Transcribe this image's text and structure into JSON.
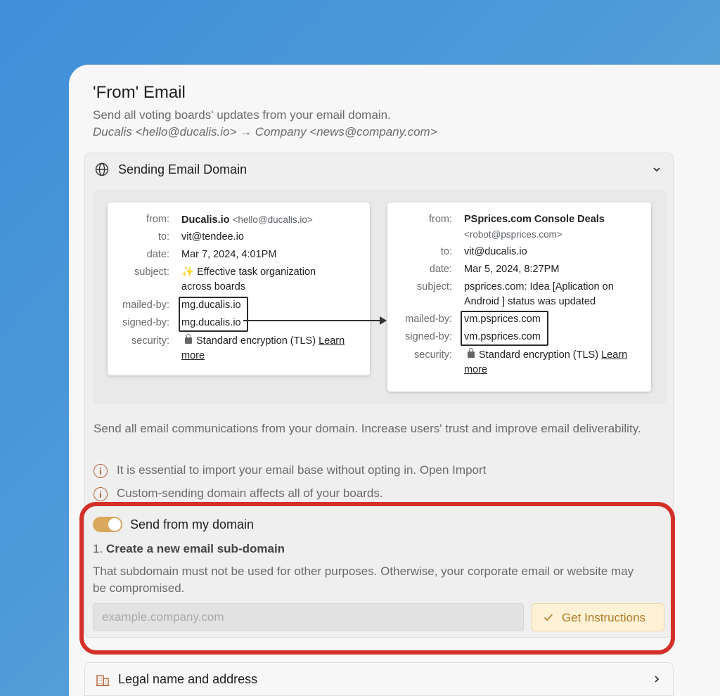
{
  "header": {
    "title": "'From' Email",
    "subtitle": "Send all voting boards' updates from your email domain.",
    "example": "Ducalis <hello@ducalis.io> → Company <news@company.com>"
  },
  "sending_section": {
    "title": "Sending Email Domain",
    "icon": "globe-icon",
    "expanded": true
  },
  "email_left": {
    "labels": {
      "from": "from:",
      "to": "to:",
      "date": "date:",
      "subject": "subject:",
      "mailed_by": "mailed-by:",
      "signed_by": "signed-by:",
      "security": "security:"
    },
    "from_name": "Ducalis.io",
    "from_addr": "<hello@ducalis.io>",
    "to": "vit@tendee.io",
    "date": "Mar 7, 2024, 4:01PM",
    "subject_line1": "✨ Effective task organization",
    "subject_line2": "across boards",
    "mailed_by": "mg.ducalis.io",
    "signed_by": "mg.ducalis.io",
    "security": "Standard encryption (TLS)",
    "learn": "Learn",
    "more": "more"
  },
  "email_right": {
    "labels": {
      "from": "from:",
      "to": "to:",
      "date": "date:",
      "subject": "subject:",
      "mailed_by": "mailed-by:",
      "signed_by": "signed-by:",
      "security": "security:"
    },
    "from_name": "PSprices.com Console Deals",
    "from_addr": "<robot@psprices.com>",
    "to": "vit@ducalis.io",
    "date": "Mar 5, 2024, 8:27PM",
    "subject_line1": "psprices.com: Idea [Aplication on",
    "subject_line2": "Android ] status was updated",
    "mailed_by": "vm.psprices.com",
    "signed_by": "vm.psprices.com",
    "security": "Standard encryption (TLS)",
    "learn": "Learn",
    "more": "more"
  },
  "description": "Send all email communications from your domain. Increase users' trust and improve email deliverability.",
  "notes": [
    "It is essential to import your email base without opting in. Open Import",
    "Custom-sending domain affects all of your boards."
  ],
  "toggle": {
    "label": "Send from my domain",
    "on": true,
    "color": "#d9a85c"
  },
  "step": {
    "number": "1.",
    "title": "Create a new email sub-domain",
    "description": "That subdomain must not be used for other purposes. Otherwise, your corporate email or website may be compromised."
  },
  "input": {
    "placeholder": "example.company.com",
    "value": ""
  },
  "button": {
    "label": "Get Instructions"
  },
  "legal_section": {
    "title": "Legal name and address",
    "icon": "building-icon"
  },
  "colors": {
    "highlight": "#d3302a",
    "accent": "#b7653a",
    "button_text": "#b47a25"
  }
}
